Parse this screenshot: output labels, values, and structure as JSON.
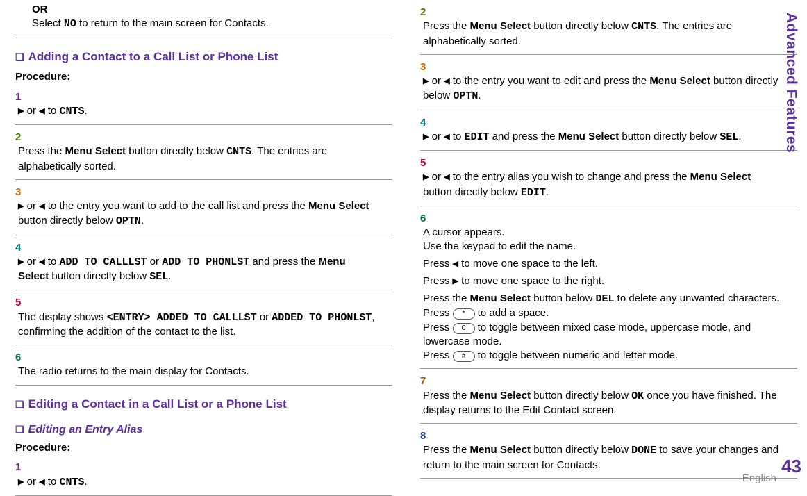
{
  "left": {
    "orLabel": "OR",
    "orLine": "Select ",
    "no": "NO",
    "orLine2": " to return to the main screen for Contacts.",
    "heading_add": "Adding a Contact to a Call List or Phone List",
    "procedure": "Procedure:",
    "step1a": " or ",
    "step1b": " to ",
    "cnts": "CNTS",
    "period": ".",
    "step2a": "Press the ",
    "menuSelect": "Menu Select",
    "step2b": " button directly below ",
    "step2c": ". The entries are alphabetically sorted.",
    "step3a": " or ",
    "step3b": " to the entry you want to add to the call list and press the ",
    "step3c": " button directly below ",
    "optn": "OPTN",
    "step4a": " or ",
    "step4b": " to ",
    "addcall": "ADD TO CALLLST",
    "orText": " or ",
    "addphon": "ADD TO PHONLST",
    "step4c": " and press the ",
    "step4d": " button directly below ",
    "sel": "SEL",
    "step5a": "The display shows ",
    "entryAdded": "<ENTRY> ADDED TO CALLLST",
    "step5or": " or ",
    "addedPhon": "ADDED TO PHONLST",
    "step5b": ", confirming the addition of the contact to the list.",
    "step6": "The radio returns to the main display for Contacts.",
    "heading_edit": "Editing a Contact in a Call List or a Phone List",
    "heading_alias": "Editing an Entry Alias",
    "procedure2": "Procedure:",
    "b_step1a": " or ",
    "b_step1b": " to "
  },
  "right": {
    "step2a": "Press the ",
    "menuSelect": "Menu Select",
    "step2b": " button directly below ",
    "cnts": "CNTS",
    "step2c": ". The entries are alphabetically sorted.",
    "step3a": " or ",
    "step3b": " to the entry you want to edit and press the ",
    "step3c": " button directly below ",
    "optn": "OPTN",
    "period": ".",
    "step4a": " or ",
    "step4b": " to ",
    "edit": "EDIT",
    "step4c": " and press the ",
    "step4d": " button directly below ",
    "sel": "SEL",
    "step5a": " or ",
    "step5b": " to the entry alias you wish to change and press the ",
    "step5c": " button directly below ",
    "s6a": "A cursor appears.",
    "s6b": "Use the keypad to edit the name.",
    "s6c1": "Press ",
    "s6c2": " to move one space to the left.",
    "s6d1": "Press ",
    "s6d2": " to move one space to the right.",
    "s6e1": "Press the ",
    "s6e2": " button below ",
    "del": "DEL",
    "s6e3": " to delete any unwanted characters.",
    "s6f1": "Press ",
    "keyStar": "*",
    "s6f2": " to add a space.",
    "s6g1": "Press ",
    "key0": "0",
    "s6g2": " to toggle between mixed case mode, uppercase mode, and lowercase mode.",
    "s6h1": "Press ",
    "keyHash": "#",
    "s6h2": " to toggle between numeric and letter mode.",
    "s7a": "Press the ",
    "s7b": " button directly below ",
    "ok": "OK",
    "s7c": " once you have finished. The display returns to the Edit Contact screen.",
    "s8a": "Press the ",
    "s8b": " button directly below ",
    "done": "DONE",
    "s8c": " to save your changes and return to the main screen for Contacts."
  },
  "labels": {
    "n1": "1",
    "n2": "2",
    "n3": "3",
    "n4": "4",
    "n5": "5",
    "n6": "6",
    "n7": "7",
    "n8": "8"
  },
  "sidebar": {
    "title": "Advanced Features",
    "pagenum": "43",
    "lang": "English"
  }
}
